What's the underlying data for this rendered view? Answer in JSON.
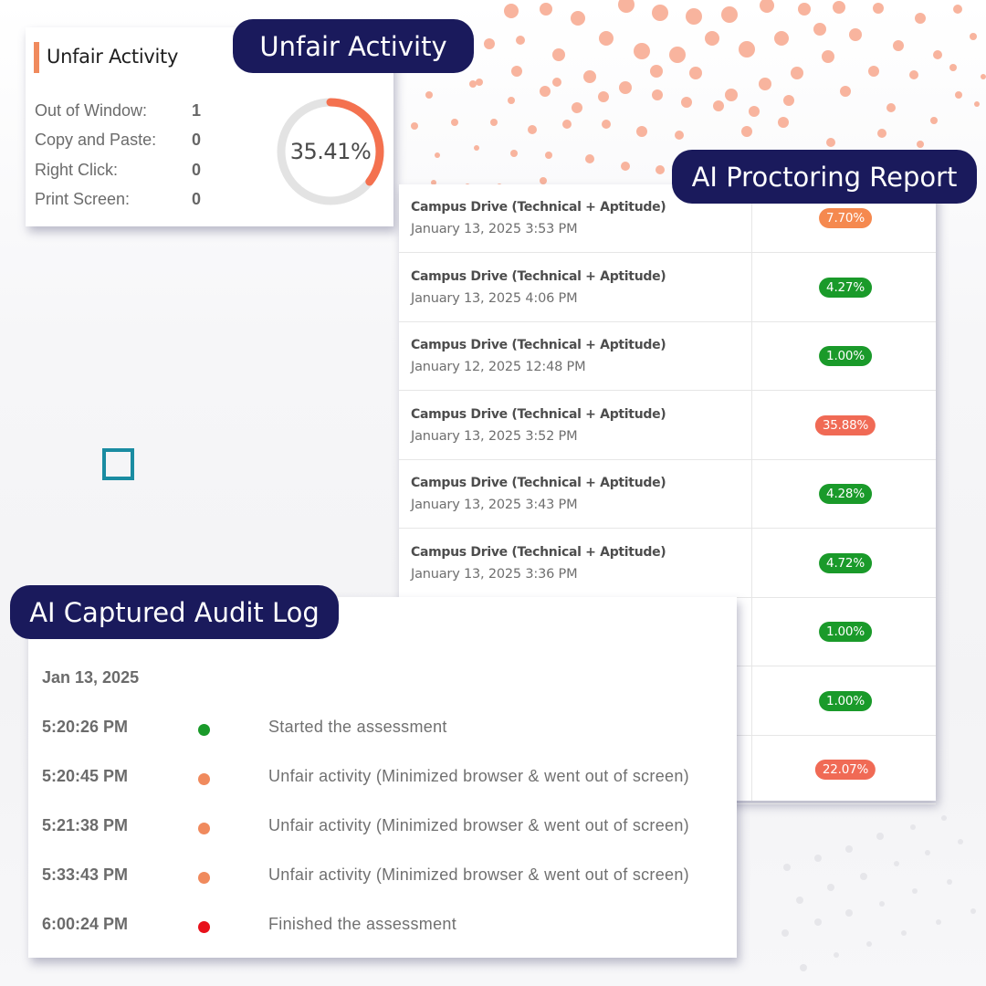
{
  "unfair_activity": {
    "heading": "Unfair Activity",
    "pill_label": "Unfair Activity",
    "rows": [
      {
        "label": "Out of Window:",
        "value": "1"
      },
      {
        "label": "Copy and Paste:",
        "value": "0"
      },
      {
        "label": "Right Click:",
        "value": "0"
      },
      {
        "label": "Print Screen:",
        "value": "0"
      }
    ],
    "score_text": "35.41%",
    "score_fraction": 0.3541,
    "colors": {
      "accent": "#f4714f",
      "track": "#e3e3e3"
    }
  },
  "proctoring_report": {
    "pill_label": "AI Proctoring Report",
    "rows": [
      {
        "name": "Campus Drive (Technical + Aptitude)",
        "date": "January 13, 2025 3:53 PM",
        "score": "7.70%",
        "level": "orange"
      },
      {
        "name": "Campus Drive (Technical + Aptitude)",
        "date": "January 13, 2025 4:06 PM",
        "score": "4.27%",
        "level": "green"
      },
      {
        "name": "Campus Drive (Technical + Aptitude)",
        "date": "January 12, 2025 12:48 PM",
        "score": "1.00%",
        "level": "green"
      },
      {
        "name": "Campus Drive (Technical + Aptitude)",
        "date": "January 13, 2025 3:52 PM",
        "score": "35.88%",
        "level": "red"
      },
      {
        "name": "Campus Drive (Technical + Aptitude)",
        "date": "January 13, 2025 3:43 PM",
        "score": "4.28%",
        "level": "green"
      },
      {
        "name": "Campus Drive (Technical + Aptitude)",
        "date": "January 13, 2025 3:36 PM",
        "score": "4.72%",
        "level": "green"
      },
      {
        "name": "",
        "date": "",
        "score": "1.00%",
        "level": "green"
      },
      {
        "name": "",
        "date": "",
        "score": "1.00%",
        "level": "green"
      },
      {
        "name": "",
        "date": "",
        "score": "22.07%",
        "level": "red"
      }
    ],
    "colors": {
      "green": "#1a9a2a",
      "orange": "#f5894f",
      "red": "#f06a55"
    }
  },
  "audit_log": {
    "pill_label": "AI Captured Audit Log",
    "date": "Jan 13, 2025",
    "entries": [
      {
        "time": "5:20:26 PM",
        "event": "Started the assessment",
        "status": "green"
      },
      {
        "time": "5:20:45 PM",
        "event": "Unfair activity (Minimized browser & went out of screen)",
        "status": "orange"
      },
      {
        "time": "5:21:38 PM",
        "event": "Unfair activity (Minimized browser & went out of screen)",
        "status": "orange"
      },
      {
        "time": "5:33:43 PM",
        "event": "Unfair activity (Minimized browser & went out of screen)",
        "status": "orange"
      },
      {
        "time": "6:00:24 PM",
        "event": "Finished the assessment",
        "status": "red"
      }
    ],
    "colors": {
      "green": "#1a9a2a",
      "orange": "#f08a5d",
      "red": "#e8111b"
    }
  },
  "brand_colors": {
    "pill_bg": "#1a1a5c",
    "dot": "#f8b49e",
    "square": "#1a8ca2"
  }
}
